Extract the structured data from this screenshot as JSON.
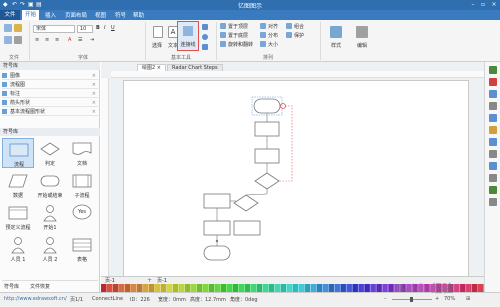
{
  "titlebar": {
    "title": "亿图图示",
    "minimize": "–",
    "maximize": "▫",
    "close": "×"
  },
  "menu": {
    "items": [
      "文件",
      "开始",
      "插入",
      "页面布局",
      "视图",
      "符号",
      "帮助"
    ],
    "active_index": 1
  },
  "ribbon": {
    "font_name": "宋体",
    "font_size": "10",
    "groups": [
      "文件",
      "字体",
      "基本工具",
      "排列"
    ],
    "tools": {
      "select": "选择",
      "text": "文本",
      "connector": "连接线"
    },
    "arrange": {
      "bring_front": "置于顶层",
      "send_back": "置于底层",
      "rotate_flip": "旋转和翻转",
      "align": "对齐",
      "distribute": "分布",
      "group": "组合",
      "size": "大小",
      "lock": "保护"
    },
    "style": "样式",
    "edit": "编辑"
  },
  "library": {
    "header": "符号库",
    "rows": [
      "图像",
      "流程图",
      "标注",
      "箭头形状",
      "基本流程图形状"
    ],
    "shapes_header": "符号库",
    "shapes": [
      "流程",
      "判定",
      "文档",
      "数据",
      "开始或结束",
      "子流程",
      "预定义流程",
      "开始1",
      "Yes",
      "人员 1",
      "人员 2",
      "表格"
    ],
    "bottom_tabs": [
      "符号库",
      "文件恢复"
    ]
  },
  "canvas": {
    "tabs": [
      "绘图2",
      "Radar Chart Steps"
    ],
    "page_tab": "页-1",
    "add_page": "+",
    "page_label": "页-1"
  },
  "status": {
    "url": "http://www.edrawsoft.cn/",
    "page": "页1/1",
    "shape": "ConnectLine",
    "id": "ID：226",
    "width": "宽度：0mm",
    "height": "高度：12.7mm",
    "angle": "角度：0deg",
    "zoom": "70%"
  },
  "watermark": "Baidu经验",
  "colors": {
    "titlebar": "#2f6fb0",
    "selected_tool": "#e05050",
    "shape_stroke": "#777777"
  }
}
